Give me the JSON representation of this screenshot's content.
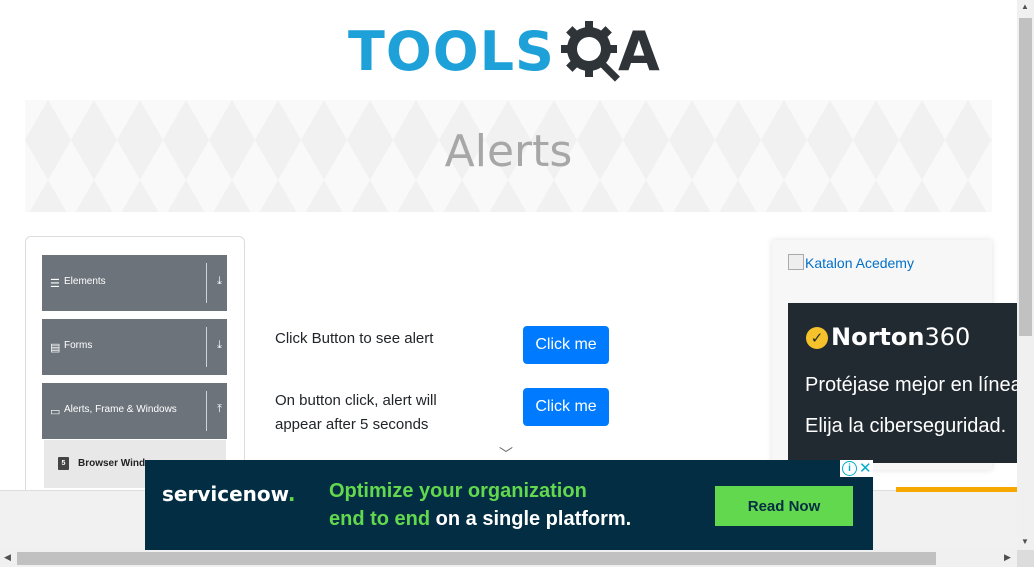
{
  "header": {
    "logo_text": "TOOLSQA"
  },
  "banner": {
    "title": "Alerts"
  },
  "sidebar": {
    "groups": [
      {
        "label": "Elements",
        "icon": "hamburger-icon"
      },
      {
        "label": "Forms",
        "icon": "form-icon"
      },
      {
        "label": "Alerts, Frame & Windows",
        "icon": "window-icon"
      }
    ],
    "subitem": {
      "label": "Browser Windows",
      "icon": "html5-icon"
    }
  },
  "main": {
    "rows": [
      {
        "text": "Click Button to see alert",
        "button_label": "Click me"
      },
      {
        "text": "On button click, alert will appear after 5 seconds",
        "button_label": "Click me"
      }
    ]
  },
  "side_ads": {
    "katalon_alt": "Katalon Acedemy",
    "norton": {
      "brand_bold": "Norton",
      "brand_num": "360",
      "line1": "Protéjase mejor en línea",
      "line2": "Elija la ciberseguridad."
    }
  },
  "bottom_ad": {
    "logo_text": "servicenow",
    "logo_dot": ".",
    "line1": "Optimize your organization",
    "line2_green": "end to end",
    "line2_rest": " on a single platform.",
    "cta": "Read Now"
  },
  "colors": {
    "accent_blue": "#007bff",
    "sidebar_group": "#6c737b",
    "servicenow_bg": "#032d42",
    "servicenow_green": "#62d84e",
    "norton_bg": "#222a31",
    "norton_yellow": "#f6c22b"
  }
}
